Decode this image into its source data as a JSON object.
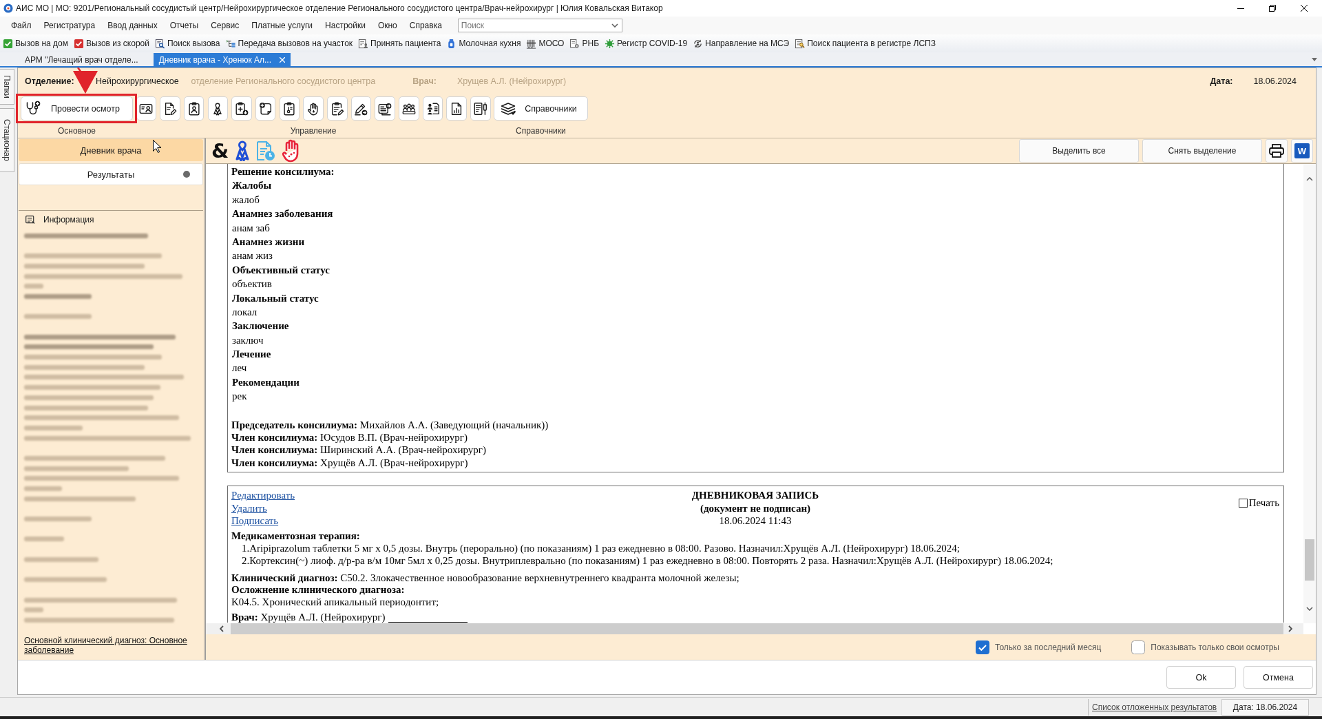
{
  "window": {
    "title": "АИС МО | МО: 9201/Региональный сосудистый центр/Нейрохирургическое отделение Регионального сосудистого центра/Врач-нейрохирург | Юлия Ковальская Витакор"
  },
  "menu": [
    "Файл",
    "Регистратура",
    "Ввод данных",
    "Отчеты",
    "Сервис",
    "Платные услуги",
    "Настройки",
    "Окно",
    "Справка"
  ],
  "search": {
    "placeholder": "Поиск"
  },
  "quick_toolbar": [
    "Вызов на дом",
    "Вызов из скорой",
    "Поиск вызова",
    "Передача вызовов на участок",
    "Принять пациента",
    "Молочная кухня",
    "МОСО",
    "РНБ",
    "Регистр COVID-19",
    "Направление на МСЭ",
    "Поиск пациента в регистре ЛСПЗ"
  ],
  "doc_tabs": [
    {
      "label": "АРМ \"Лечащий врач отделе...",
      "selected": false
    },
    {
      "label": "Дневник врача - Хренюк Ал...",
      "selected": true
    }
  ],
  "side_tabs": [
    "Папки",
    "Стационар"
  ],
  "header": {
    "department_label": "Отделение:",
    "department": [
      {
        "text": "Нейрохирургическое",
        "blurred": false
      },
      {
        "text": "отделение Регионального сосудистого центра",
        "blurred": true
      }
    ],
    "doctor_label": {
      "text": "Врач:",
      "blurred": true
    },
    "doctor": {
      "text": "Хрущев А.Л. (Нейрохирург)",
      "blurred": true
    },
    "date_label": "Дата:",
    "date": "18.06.2024"
  },
  "ribbon": {
    "primary": {
      "label": "Провести осмотр",
      "highlighted": true
    },
    "reference_button": "Справочники",
    "groups": [
      "Основное",
      "Управление",
      "Справочники"
    ]
  },
  "nav": [
    {
      "label": "Дневник врача",
      "selected": true,
      "badge": false
    },
    {
      "label": "Результаты",
      "selected": false,
      "badge": true
    }
  ],
  "info_panel": {
    "title": "Информация",
    "link": "Основной клинический диагноз: Основное заболевание"
  },
  "content_toolbar": {
    "symbol": "&",
    "buttons": [
      "Выделить все",
      "Снять выделение"
    ],
    "export_label": "W"
  },
  "consilium": {
    "heading": "Решение консилиума:",
    "sections": [
      {
        "title": "Жалобы",
        "text": "жалоб"
      },
      {
        "title": "Анамнез заболевания",
        "text": "анам заб"
      },
      {
        "title": "Анамнез жизни",
        "text": "анам жиз"
      },
      {
        "title": "Объективный статус",
        "text": "объектив"
      },
      {
        "title": "Локальный статус",
        "text": "локал"
      },
      {
        "title": "Заключение",
        "text": "заключ"
      },
      {
        "title": "Лечение",
        "text": "леч"
      },
      {
        "title": "Рекомендации",
        "text": "рек"
      }
    ],
    "members": [
      "**Председатель консилиума:** Михайлов А.А. (Заведующий (начальник))",
      "**Член консилиума:** Юсудов В.П. (Врач-нейрохирург)",
      "**Член консилиума:** Ширинский А.А. (Врач-нейрохирург)",
      "**Член консилиума:** Хрущёв А.Л. (Врач-нейрохирург)"
    ]
  },
  "diary_entry": {
    "actions": [
      "Редактировать",
      "Удалить",
      "Подписать"
    ],
    "title": "ДНЕВНИКОВАЯ ЗАПИСЬ",
    "subtitle": "(документ не подписан)",
    "datetime": "18.06.2024 11:43",
    "print": {
      "label": "Печать",
      "checked": false
    },
    "therapy_title": "Медикаментозная терапия:",
    "therapy": [
      "1.Aripiprazolum таблетки 5 мг x 0,5 дозы. Внутрь (перорально) (по показаниям) 1 раз ежедневно в 08:00. Разово. Назначил:Хрущёв А.Л. (Нейрохирург) 18.06.2024;",
      "2.Кортексин(~) лиоф. д/р-ра в/м 10мг 5мл x 0,25 дозы. Внутриплеврально (по показаниям) 1 раз ежедневно в 08:00. Повторять 2 раза. Назначил:Хрущёв А.Л. (Нейрохирург) 18.06.2024;"
    ],
    "diagnosis": "**Клинический диагноз:** C50.2. Злокачественное новообразование верхневнутреннего квадранта молочной железы;",
    "complication_title": "Осложнение клинического диагноза:",
    "complication": "K04.5. Хронический апикальный периодонтит;",
    "doctor": "**Врач:** Хрущёв А.Л. (Нейрохирург)"
  },
  "filters": [
    {
      "label": "Только за последний месяц",
      "checked": true
    },
    {
      "label": "Показывать только свои осмотры",
      "checked": false
    }
  ],
  "dialog_buttons": [
    "Ok",
    "Отмена"
  ],
  "status_bar": {
    "link": "Список отложенных результатов",
    "date": "Дата: 18.06.2024"
  }
}
